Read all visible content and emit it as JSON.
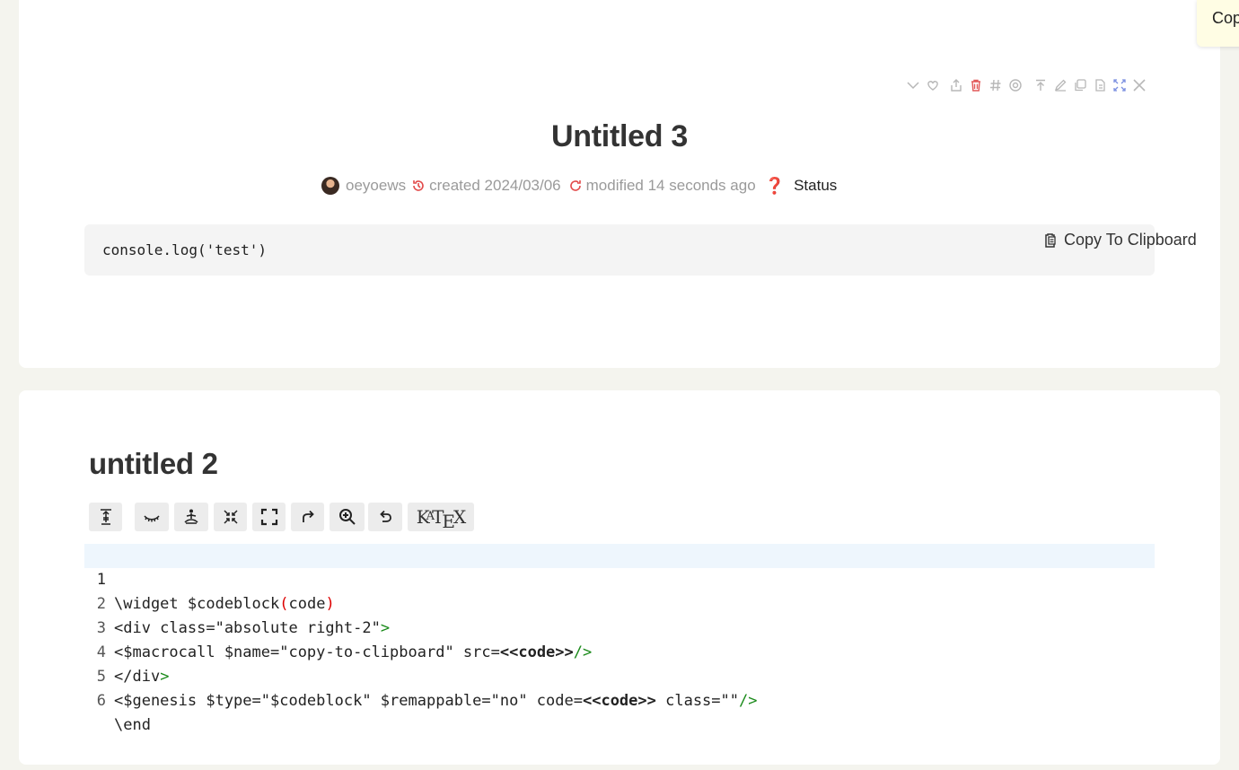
{
  "notification": {
    "text": "Copy"
  },
  "tiddler1": {
    "toolbar_icons": [
      "chevron-down-icon",
      "heart-icon",
      "share-icon",
      "trash-icon",
      "hash-icon",
      "target-icon",
      "top-arrow-icon",
      "edit-icon",
      "copy-icon",
      "export-icon",
      "fullscreen-icon",
      "close-icon"
    ],
    "title": "Untitled 3",
    "meta": {
      "author": "oeyoews",
      "created": "created 2024/03/06",
      "modified": "modified 14 seconds ago",
      "status_icon": "❓",
      "status": "Status"
    },
    "code": "console.log('test')",
    "copy_label": "Copy To Clipboard"
  },
  "tiddler2": {
    "title": "untitled 2",
    "editor_toolbar": [
      "stamp-icon",
      "eye-closed-icon",
      "meditate-icon",
      "fold-icon",
      "fullscreen-icon",
      "redo-icon",
      "search-icon",
      "undo-icon",
      "katex-button"
    ],
    "katex_label": "KaTeX",
    "code_lines": [
      {
        "n": "1"
      },
      {
        "n": "2"
      },
      {
        "n": "3"
      },
      {
        "n": "4"
      },
      {
        "n": "5"
      },
      {
        "n": "6"
      }
    ],
    "code_text": {
      "l1": [
        "\\widget $codeblock",
        "(",
        "code",
        ")"
      ],
      "l2": [
        "<div class=\"absolute right-2\"",
        ">"
      ],
      "l3": [
        "<$macrocall $name=\"copy-to-clipboard\" src=",
        "<<code>>",
        "/>"
      ],
      "l4": [
        "</",
        "div",
        ">"
      ],
      "l5": [
        "<$genesis $type=\"$codeblock\" $remappable=\"no\" code=",
        "<<code>>",
        " class=\"\"",
        "/>"
      ],
      "l6": [
        "\\end"
      ]
    }
  },
  "colors": {
    "accent_red": "#d22",
    "tag_green": "#1a8a1a",
    "page_bg": "#f4f4ee"
  }
}
